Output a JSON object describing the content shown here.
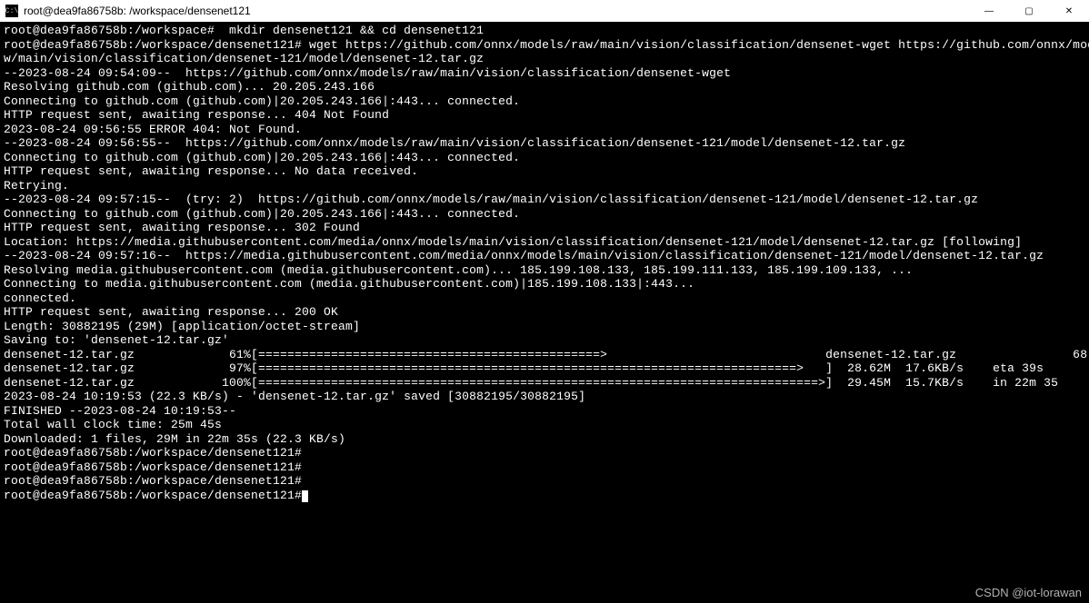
{
  "window": {
    "icon_label": "C:\\",
    "title": "root@dea9fa86758b: /workspace/densenet121"
  },
  "watermark": "CSDN @iot-lorawan",
  "lines": [
    "root@dea9fa86758b:/workspace#  mkdir densenet121 && cd densenet121",
    "root@dea9fa86758b:/workspace/densenet121# wget https://github.com/onnx/models/raw/main/vision/classification/densenet-wget https://github.com/onnx/models",
    "w/main/vision/classification/densenet-121/model/densenet-12.tar.gz",
    "--2023-08-24 09:54:09--  https://github.com/onnx/models/raw/main/vision/classification/densenet-wget",
    "Resolving github.com (github.com)... 20.205.243.166",
    "Connecting to github.com (github.com)|20.205.243.166|:443... connected.",
    "HTTP request sent, awaiting response... 404 Not Found",
    "",
    "2023-08-24 09:56:55 ERROR 404: Not Found.",
    "",
    "--2023-08-24 09:56:55--  https://github.com/onnx/models/raw/main/vision/classification/densenet-121/model/densenet-12.tar.gz",
    "Connecting to github.com (github.com)|20.205.243.166|:443... connected.",
    "HTTP request sent, awaiting response... No data received.",
    "Retrying.",
    "",
    "--2023-08-24 09:57:15--  (try: 2)  https://github.com/onnx/models/raw/main/vision/classification/densenet-121/model/densenet-12.tar.gz",
    "Connecting to github.com (github.com)|20.205.243.166|:443... connected.",
    "HTTP request sent, awaiting response... 302 Found",
    "Location: https://media.githubusercontent.com/media/onnx/models/main/vision/classification/densenet-121/model/densenet-12.tar.gz [following]",
    "--2023-08-24 09:57:16--  https://media.githubusercontent.com/media/onnx/models/main/vision/classification/densenet-121/model/densenet-12.tar.gz",
    "Resolving media.githubusercontent.com (media.githubusercontent.com)... 185.199.108.133, 185.199.111.133, 185.199.109.133, ...",
    "Connecting to media.githubusercontent.com (media.githubusercontent.com)|185.199.108.133|:443...",
    "",
    "connected.",
    "HTTP request sent, awaiting response... 200 OK",
    "Length: 30882195 (29M) [application/octet-stream]",
    "Saving to: 'densenet-12.tar.gz'",
    "",
    "densenet-12.tar.gz             61%[===============================================>                              densenet-12.tar.gz                68",
    "densenet-12.tar.gz             97%[==========================================================================>   ]  28.62M  17.6KB/s    eta 39s   ",
    "densenet-12.tar.gz            100%[=============================================================================>]  29.45M  15.7KB/s    in 22m 35",
    "",
    "2023-08-24 10:19:53 (22.3 KB/s) - 'densenet-12.tar.gz' saved [30882195/30882195]",
    "",
    "FINISHED --2023-08-24 10:19:53--",
    "Total wall clock time: 25m 45s",
    "Downloaded: 1 files, 29M in 22m 35s (22.3 KB/s)",
    "root@dea9fa86758b:/workspace/densenet121#",
    "root@dea9fa86758b:/workspace/densenet121#",
    "root@dea9fa86758b:/workspace/densenet121#",
    "root@dea9fa86758b:/workspace/densenet121#"
  ]
}
